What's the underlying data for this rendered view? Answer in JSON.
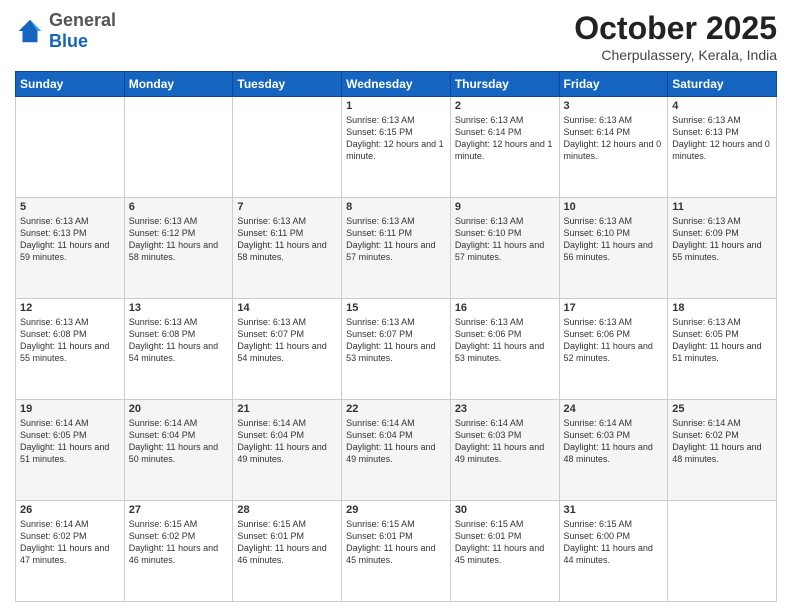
{
  "header": {
    "logo": {
      "general": "General",
      "blue": "Blue"
    },
    "title": "October 2025",
    "location": "Cherpulassery, Kerala, India"
  },
  "weekdays": [
    "Sunday",
    "Monday",
    "Tuesday",
    "Wednesday",
    "Thursday",
    "Friday",
    "Saturday"
  ],
  "weeks": [
    [
      {
        "day": "",
        "sunrise": "",
        "sunset": "",
        "daylight": ""
      },
      {
        "day": "",
        "sunrise": "",
        "sunset": "",
        "daylight": ""
      },
      {
        "day": "",
        "sunrise": "",
        "sunset": "",
        "daylight": ""
      },
      {
        "day": "1",
        "sunrise": "Sunrise: 6:13 AM",
        "sunset": "Sunset: 6:15 PM",
        "daylight": "Daylight: 12 hours and 1 minute."
      },
      {
        "day": "2",
        "sunrise": "Sunrise: 6:13 AM",
        "sunset": "Sunset: 6:14 PM",
        "daylight": "Daylight: 12 hours and 1 minute."
      },
      {
        "day": "3",
        "sunrise": "Sunrise: 6:13 AM",
        "sunset": "Sunset: 6:14 PM",
        "daylight": "Daylight: 12 hours and 0 minutes."
      },
      {
        "day": "4",
        "sunrise": "Sunrise: 6:13 AM",
        "sunset": "Sunset: 6:13 PM",
        "daylight": "Daylight: 12 hours and 0 minutes."
      }
    ],
    [
      {
        "day": "5",
        "sunrise": "Sunrise: 6:13 AM",
        "sunset": "Sunset: 6:13 PM",
        "daylight": "Daylight: 11 hours and 59 minutes."
      },
      {
        "day": "6",
        "sunrise": "Sunrise: 6:13 AM",
        "sunset": "Sunset: 6:12 PM",
        "daylight": "Daylight: 11 hours and 58 minutes."
      },
      {
        "day": "7",
        "sunrise": "Sunrise: 6:13 AM",
        "sunset": "Sunset: 6:11 PM",
        "daylight": "Daylight: 11 hours and 58 minutes."
      },
      {
        "day": "8",
        "sunrise": "Sunrise: 6:13 AM",
        "sunset": "Sunset: 6:11 PM",
        "daylight": "Daylight: 11 hours and 57 minutes."
      },
      {
        "day": "9",
        "sunrise": "Sunrise: 6:13 AM",
        "sunset": "Sunset: 6:10 PM",
        "daylight": "Daylight: 11 hours and 57 minutes."
      },
      {
        "day": "10",
        "sunrise": "Sunrise: 6:13 AM",
        "sunset": "Sunset: 6:10 PM",
        "daylight": "Daylight: 11 hours and 56 minutes."
      },
      {
        "day": "11",
        "sunrise": "Sunrise: 6:13 AM",
        "sunset": "Sunset: 6:09 PM",
        "daylight": "Daylight: 11 hours and 55 minutes."
      }
    ],
    [
      {
        "day": "12",
        "sunrise": "Sunrise: 6:13 AM",
        "sunset": "Sunset: 6:08 PM",
        "daylight": "Daylight: 11 hours and 55 minutes."
      },
      {
        "day": "13",
        "sunrise": "Sunrise: 6:13 AM",
        "sunset": "Sunset: 6:08 PM",
        "daylight": "Daylight: 11 hours and 54 minutes."
      },
      {
        "day": "14",
        "sunrise": "Sunrise: 6:13 AM",
        "sunset": "Sunset: 6:07 PM",
        "daylight": "Daylight: 11 hours and 54 minutes."
      },
      {
        "day": "15",
        "sunrise": "Sunrise: 6:13 AM",
        "sunset": "Sunset: 6:07 PM",
        "daylight": "Daylight: 11 hours and 53 minutes."
      },
      {
        "day": "16",
        "sunrise": "Sunrise: 6:13 AM",
        "sunset": "Sunset: 6:06 PM",
        "daylight": "Daylight: 11 hours and 53 minutes."
      },
      {
        "day": "17",
        "sunrise": "Sunrise: 6:13 AM",
        "sunset": "Sunset: 6:06 PM",
        "daylight": "Daylight: 11 hours and 52 minutes."
      },
      {
        "day": "18",
        "sunrise": "Sunrise: 6:13 AM",
        "sunset": "Sunset: 6:05 PM",
        "daylight": "Daylight: 11 hours and 51 minutes."
      }
    ],
    [
      {
        "day": "19",
        "sunrise": "Sunrise: 6:14 AM",
        "sunset": "Sunset: 6:05 PM",
        "daylight": "Daylight: 11 hours and 51 minutes."
      },
      {
        "day": "20",
        "sunrise": "Sunrise: 6:14 AM",
        "sunset": "Sunset: 6:04 PM",
        "daylight": "Daylight: 11 hours and 50 minutes."
      },
      {
        "day": "21",
        "sunrise": "Sunrise: 6:14 AM",
        "sunset": "Sunset: 6:04 PM",
        "daylight": "Daylight: 11 hours and 49 minutes."
      },
      {
        "day": "22",
        "sunrise": "Sunrise: 6:14 AM",
        "sunset": "Sunset: 6:04 PM",
        "daylight": "Daylight: 11 hours and 49 minutes."
      },
      {
        "day": "23",
        "sunrise": "Sunrise: 6:14 AM",
        "sunset": "Sunset: 6:03 PM",
        "daylight": "Daylight: 11 hours and 49 minutes."
      },
      {
        "day": "24",
        "sunrise": "Sunrise: 6:14 AM",
        "sunset": "Sunset: 6:03 PM",
        "daylight": "Daylight: 11 hours and 48 minutes."
      },
      {
        "day": "25",
        "sunrise": "Sunrise: 6:14 AM",
        "sunset": "Sunset: 6:02 PM",
        "daylight": "Daylight: 11 hours and 48 minutes."
      }
    ],
    [
      {
        "day": "26",
        "sunrise": "Sunrise: 6:14 AM",
        "sunset": "Sunset: 6:02 PM",
        "daylight": "Daylight: 11 hours and 47 minutes."
      },
      {
        "day": "27",
        "sunrise": "Sunrise: 6:15 AM",
        "sunset": "Sunset: 6:02 PM",
        "daylight": "Daylight: 11 hours and 46 minutes."
      },
      {
        "day": "28",
        "sunrise": "Sunrise: 6:15 AM",
        "sunset": "Sunset: 6:01 PM",
        "daylight": "Daylight: 11 hours and 46 minutes."
      },
      {
        "day": "29",
        "sunrise": "Sunrise: 6:15 AM",
        "sunset": "Sunset: 6:01 PM",
        "daylight": "Daylight: 11 hours and 45 minutes."
      },
      {
        "day": "30",
        "sunrise": "Sunrise: 6:15 AM",
        "sunset": "Sunset: 6:01 PM",
        "daylight": "Daylight: 11 hours and 45 minutes."
      },
      {
        "day": "31",
        "sunrise": "Sunrise: 6:15 AM",
        "sunset": "Sunset: 6:00 PM",
        "daylight": "Daylight: 11 hours and 44 minutes."
      },
      {
        "day": "",
        "sunrise": "",
        "sunset": "",
        "daylight": ""
      }
    ]
  ]
}
